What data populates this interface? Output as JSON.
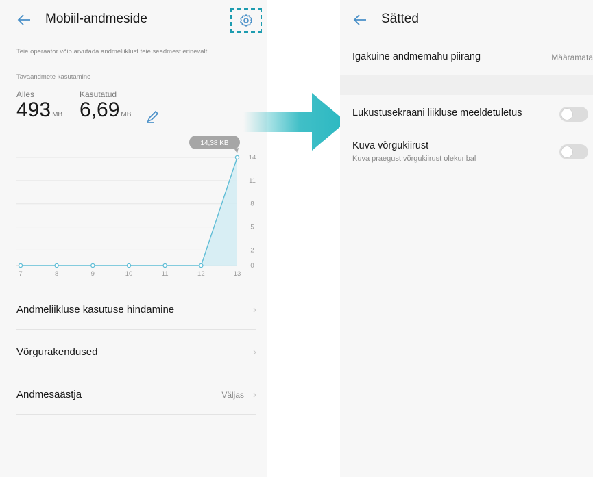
{
  "left_screen": {
    "title": "Mobiil-andmeside",
    "note": "Teie operaator võib arvutada andmeliiklust teie seadmest erinevalt.",
    "subheading": "Tavaandmete kasutamine",
    "remaining_label": "Alles",
    "remaining_value": "493",
    "remaining_unit": "MB",
    "used_label": "Kasutatud",
    "used_value": "6,69",
    "used_unit": "MB",
    "menu": [
      {
        "label": "Andmeliikluse kasutuse hindamine",
        "value": ""
      },
      {
        "label": "Võrgurakendused",
        "value": ""
      },
      {
        "label": "Andmesäästja",
        "value": "Väljas"
      }
    ]
  },
  "chart_data": {
    "type": "area",
    "x": [
      7,
      8,
      9,
      10,
      11,
      12,
      13
    ],
    "y": [
      0,
      0,
      0,
      0,
      0,
      0,
      14
    ],
    "x_tick_labels": [
      "7",
      "8",
      "9",
      "10",
      "11",
      "12",
      "13"
    ],
    "y_ticks": [
      0,
      2,
      5,
      8,
      11,
      14
    ],
    "ylim": [
      0,
      14
    ],
    "callout": "14,38 KB",
    "line_color": "#5fbdd6",
    "fill_color": "#d2ecf3"
  },
  "right_screen": {
    "title": "Sätted",
    "limit_label": "Igakuine andmemahu piirang",
    "limit_value": "Määramata",
    "lock_reminder_label": "Lukustusekraani liikluse meeldetuletus",
    "lock_reminder_on": false,
    "network_speed_label": "Kuva võrgukiirust",
    "network_speed_sub": "Kuva praegust võrgukiirust olekuribal",
    "network_speed_on": false
  },
  "colors": {
    "accent": "#1d9cb0",
    "arrow": "#2bb8c1"
  },
  "icons": {
    "back": "arrow-left-icon",
    "settings": "gear-icon",
    "edit": "pencil-icon",
    "chevron": "chevron-right-icon"
  }
}
